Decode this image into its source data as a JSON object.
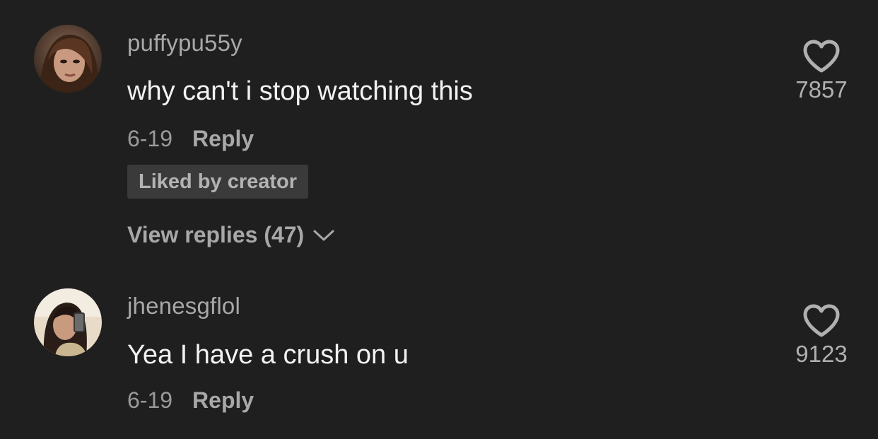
{
  "comments": [
    {
      "username": "puffypu55y",
      "text": "why can't i stop watching this",
      "date": "6-19",
      "reply_label": "Reply",
      "liked_badge": "Liked by creator",
      "view_replies": "View replies (47)",
      "like_count": "7857"
    },
    {
      "username": "jhenesgflol",
      "text": "Yea I have a crush on u",
      "date": "6-19",
      "reply_label": "Reply",
      "like_count": "9123"
    }
  ],
  "colors": {
    "background": "#1f1f1f",
    "username": "#a8a8a8",
    "text": "#f2f2f2",
    "badge_bg": "#3a3a3a"
  },
  "icons": {
    "like": "heart-outline-icon",
    "expand": "chevron-down-icon"
  }
}
